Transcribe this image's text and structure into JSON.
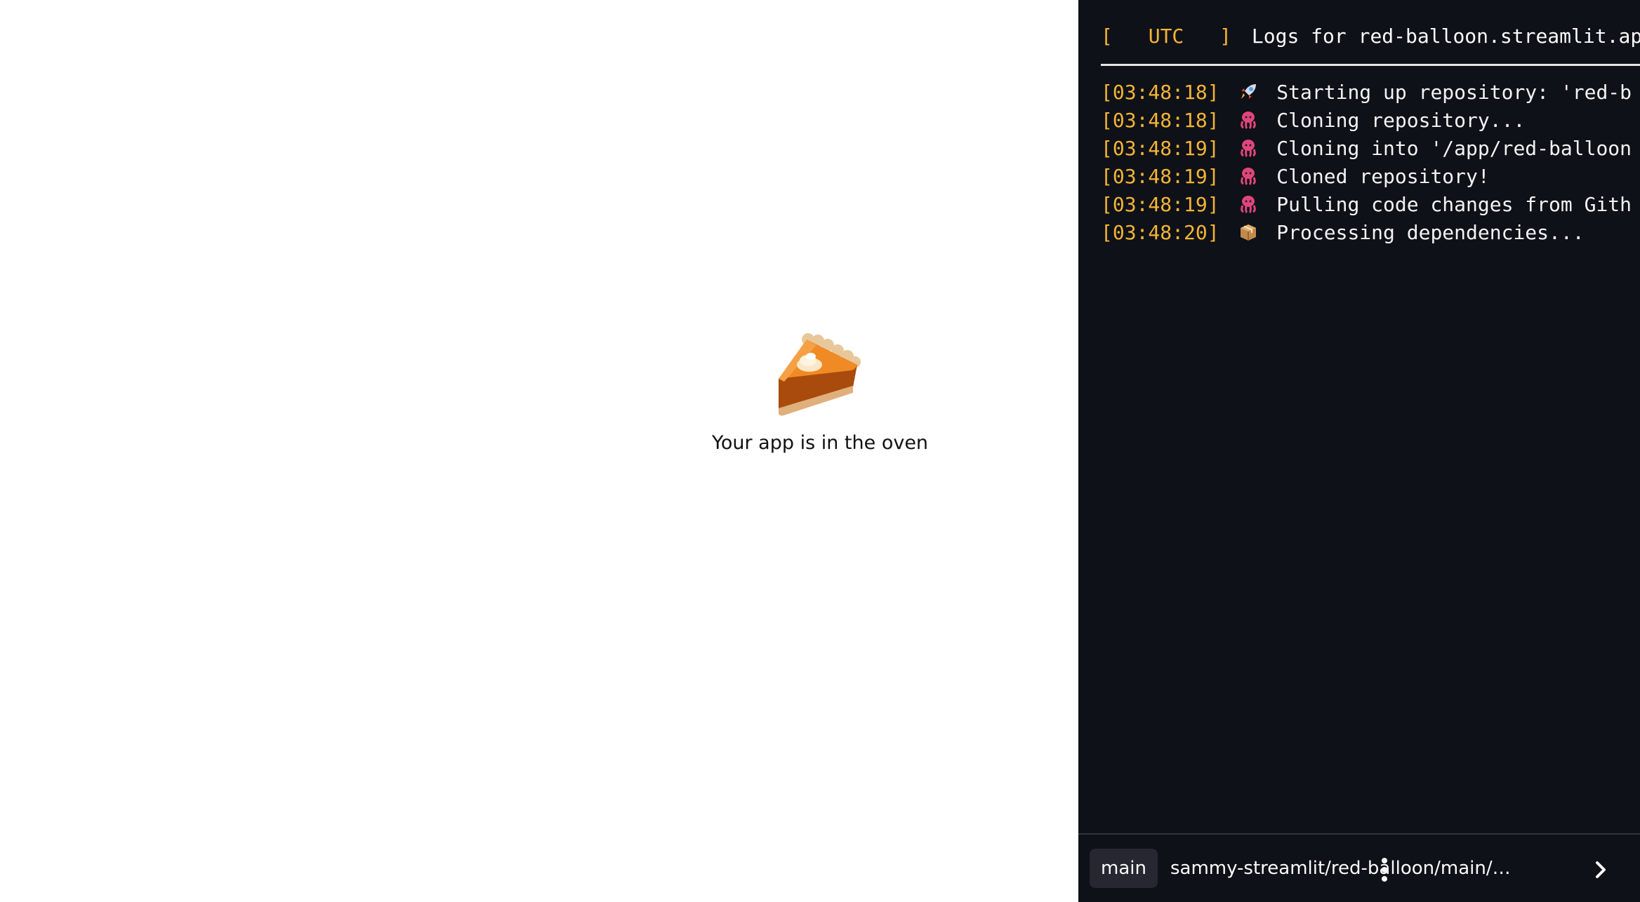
{
  "app": {
    "loading_message": "Your app is in the oven",
    "loading_icon": "pie-slice-icon"
  },
  "console": {
    "header": {
      "tz_open": "[",
      "tz_label": "UTC",
      "tz_close": "]",
      "title": "Logs for red-balloon.streamlit.app"
    },
    "logs": [
      {
        "time": "[03:48:18]",
        "icon": "rocket-icon",
        "message": "Starting up repository: 'red-balloon', branch: 'main'"
      },
      {
        "time": "[03:48:18]",
        "icon": "octopus-icon",
        "message": "Cloning repository..."
      },
      {
        "time": "[03:48:19]",
        "icon": "octopus-icon",
        "message": "Cloning into '/app/red-balloon'..."
      },
      {
        "time": "[03:48:19]",
        "icon": "octopus-icon",
        "message": "Cloned repository!"
      },
      {
        "time": "[03:48:19]",
        "icon": "octopus-icon",
        "message": "Pulling code changes from Github..."
      },
      {
        "time": "[03:48:20]",
        "icon": "package-icon",
        "message": "Processing dependencies..."
      }
    ],
    "toolbar": {
      "branch": "main",
      "repo_path": "sammy-streamlit/red-balloon/main/app.py",
      "more_icon": "vertical-dots-icon",
      "collapse_icon": "chevron-right-icon"
    }
  },
  "colors": {
    "console_bg": "#0e1117",
    "timestamp": "#f4b435",
    "badge_bg": "#262730",
    "text_light": "#fafafa"
  }
}
